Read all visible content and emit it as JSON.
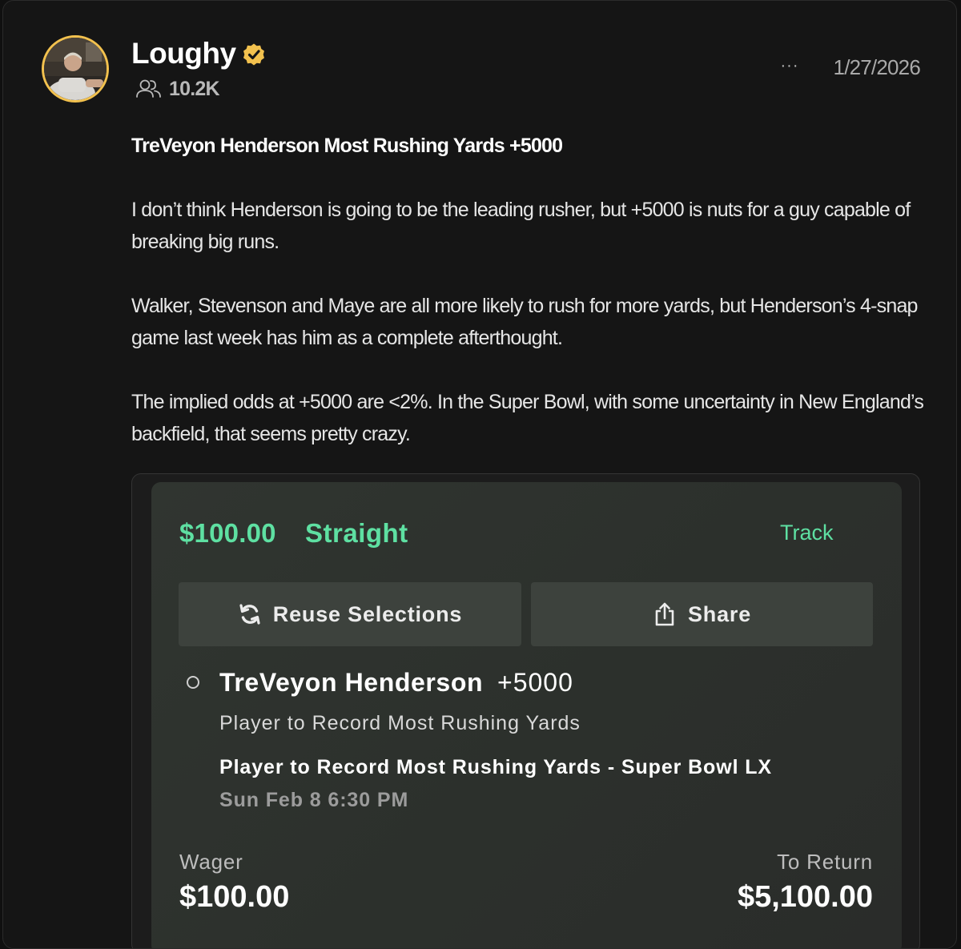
{
  "author": {
    "name": "Loughy",
    "verified_icon": "verified-badge-icon",
    "followers_icon": "followers-icon",
    "followers": "10.2K"
  },
  "post": {
    "more_icon": "···",
    "date": "1/27/2026",
    "title": "TreVeyon Henderson Most Rushing Yards +5000",
    "paragraphs": [
      "I don’t think Henderson is going to be the leading rusher, but +5000 is nuts for a guy capable of breaking big runs.",
      "Walker, Stevenson and Maye are all more likely to rush for more yards, but Henderson’s 4-snap game last week has him as a complete afterthought.",
      "The implied odds at +5000 are <2%. In the Super Bowl, with some uncertainty in New England’s backfield, that seems pretty crazy."
    ]
  },
  "bet_slip": {
    "amount": "$100.00",
    "type": "Straight",
    "track_label": "Track",
    "reuse_label": "Reuse Selections",
    "share_label": "Share",
    "selection": {
      "player": "TreVeyon Henderson",
      "odds": "+5000",
      "market": "Player to Record Most Rushing Yards",
      "event": "Player to Record Most Rushing Yards - Super Bowl LX",
      "time": "Sun Feb 8 6:30 PM"
    },
    "wager_label": "Wager",
    "wager_value": "$100.00",
    "return_label": "To Return",
    "return_value": "$5,100.00"
  },
  "colors": {
    "accent_green": "#5ee0a2",
    "verified_gold": "#f2c14e",
    "background": "#151515"
  }
}
